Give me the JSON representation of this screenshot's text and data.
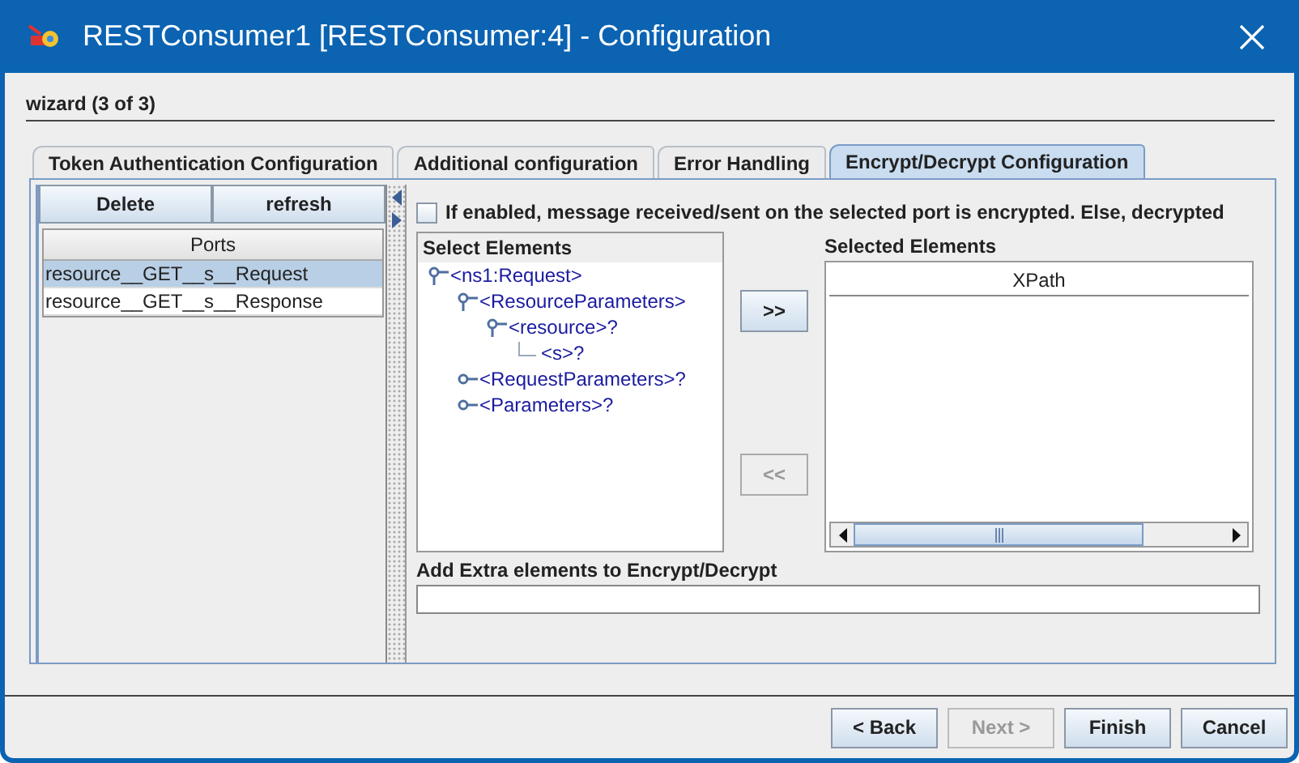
{
  "window": {
    "title": "RESTConsumer1 [RESTConsumer:4] - Configuration"
  },
  "wizard_label": "wizard (3 of 3)",
  "tabs": [
    {
      "label": "Token Authentication Configuration",
      "selected": false
    },
    {
      "label": "Additional configuration",
      "selected": false
    },
    {
      "label": "Error Handling",
      "selected": false
    },
    {
      "label": "Encrypt/Decrypt Configuration",
      "selected": true
    }
  ],
  "port_buttons": [
    {
      "label": "Delete"
    },
    {
      "label": "refresh"
    }
  ],
  "ports": {
    "column": "Ports",
    "rows": [
      {
        "name": "resource__GET__s__Request",
        "selected": true
      },
      {
        "name": "resource__GET__s__Response",
        "selected": false
      }
    ]
  },
  "encrypt_checkbox": {
    "label": "If enabled, message received/sent on the selected port is encrypted. Else, decrypted",
    "checked": false
  },
  "select_elements": {
    "title": "Select Elements",
    "tree": [
      {
        "label": "<ns1:Request>",
        "expanded": true,
        "children": [
          {
            "label": "<ResourceParameters>",
            "expanded": true,
            "children": [
              {
                "label": "<resource>?",
                "expanded": true,
                "children": [
                  {
                    "label": "<s>?"
                  }
                ]
              }
            ]
          },
          {
            "label": "<RequestParameters>?",
            "expanded": false
          },
          {
            "label": "<Parameters>?",
            "expanded": false
          }
        ]
      }
    ]
  },
  "move_buttons": [
    {
      "label": ">>",
      "disabled": false
    },
    {
      "label": "<<",
      "disabled": true
    }
  ],
  "selected_elements": {
    "title": "Selected Elements",
    "column": "XPath"
  },
  "extra_elements": {
    "label": "Add Extra elements to Encrypt/Decrypt"
  },
  "footer_buttons": [
    {
      "label": "< Back",
      "disabled": false
    },
    {
      "label": "Next >",
      "disabled": true
    },
    {
      "label": "Finish",
      "disabled": false
    },
    {
      "label": "Cancel",
      "disabled": false
    }
  ]
}
